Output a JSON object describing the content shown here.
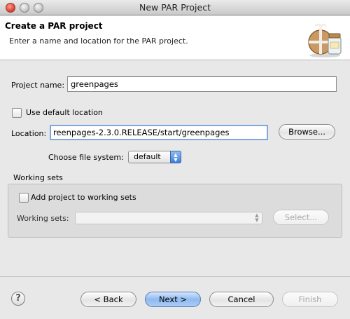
{
  "window": {
    "title": "New PAR Project"
  },
  "banner": {
    "title": "Create a PAR project",
    "description": "Enter a name and location for the PAR project."
  },
  "project_name": {
    "label": "Project name:",
    "value": "greenpages"
  },
  "default_location": {
    "label": "Use default location",
    "checked": false
  },
  "location": {
    "label": "Location:",
    "value": "reenpages-2.3.0.RELEASE/start/greenpages",
    "browse_label": "Browse..."
  },
  "file_system": {
    "label": "Choose file system:",
    "value": "default"
  },
  "working_sets": {
    "group_label": "Working sets",
    "add_label": "Add project to working sets",
    "add_checked": false,
    "combo_label": "Working sets:",
    "combo_value": "",
    "select_label": "Select..."
  },
  "footer": {
    "help_glyph": "?",
    "back_label": "< Back",
    "next_label": "Next >",
    "cancel_label": "Cancel",
    "finish_label": "Finish"
  },
  "colors": {
    "default_button": "#8fbaf0",
    "focus_ring": "#7fa7df"
  }
}
